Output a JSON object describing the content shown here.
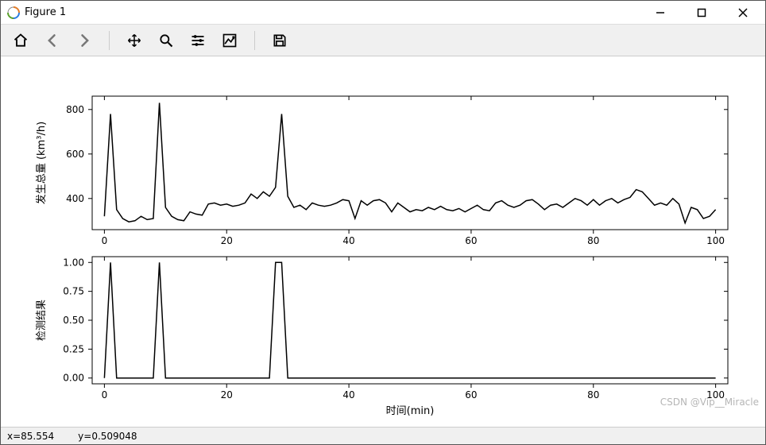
{
  "window": {
    "title": "Figure 1"
  },
  "toolbar": {
    "home": "home-icon",
    "back": "back-icon",
    "forward": "forward-icon",
    "pan": "pan-icon",
    "zoom": "zoom-icon",
    "configure": "configure-icon",
    "axes": "axes-icon",
    "save": "save-icon"
  },
  "status": {
    "x_label": "x=85.554",
    "y_label": "y=0.509048"
  },
  "watermark": "CSDN @Vip__Miracle",
  "shared_xlabel": "时间(min)",
  "chart_data": [
    {
      "type": "line",
      "title": "",
      "xlabel": "",
      "ylabel": "发生总量 (km³/h)",
      "xlim": [
        -2,
        102
      ],
      "ylim": [
        260,
        860
      ],
      "xticks": [
        0,
        20,
        40,
        60,
        80,
        100
      ],
      "yticks": [
        400,
        600,
        800
      ],
      "x": [
        0,
        1,
        2,
        3,
        4,
        5,
        6,
        7,
        8,
        9,
        10,
        11,
        12,
        13,
        14,
        15,
        16,
        17,
        18,
        19,
        20,
        21,
        22,
        23,
        24,
        25,
        26,
        27,
        28,
        29,
        30,
        31,
        32,
        33,
        34,
        35,
        36,
        37,
        38,
        39,
        40,
        41,
        42,
        43,
        44,
        45,
        46,
        47,
        48,
        49,
        50,
        51,
        52,
        53,
        54,
        55,
        56,
        57,
        58,
        59,
        60,
        61,
        62,
        63,
        64,
        65,
        66,
        67,
        68,
        69,
        70,
        71,
        72,
        73,
        74,
        75,
        76,
        77,
        78,
        79,
        80,
        81,
        82,
        83,
        84,
        85,
        86,
        87,
        88,
        89,
        90,
        91,
        92,
        93,
        94,
        95,
        96,
        97,
        98,
        99,
        100
      ],
      "values": [
        320,
        780,
        350,
        310,
        295,
        300,
        320,
        305,
        310,
        830,
        360,
        320,
        305,
        300,
        340,
        330,
        325,
        375,
        380,
        370,
        375,
        365,
        370,
        380,
        420,
        400,
        430,
        410,
        450,
        780,
        410,
        360,
        370,
        350,
        380,
        370,
        365,
        370,
        380,
        395,
        390,
        310,
        390,
        370,
        390,
        395,
        380,
        340,
        380,
        360,
        340,
        350,
        345,
        360,
        350,
        365,
        350,
        345,
        355,
        340,
        355,
        370,
        350,
        345,
        380,
        390,
        370,
        360,
        370,
        390,
        395,
        375,
        350,
        370,
        375,
        360,
        380,
        400,
        390,
        370,
        395,
        370,
        390,
        400,
        380,
        395,
        405,
        440,
        430,
        400,
        370,
        380,
        370,
        400,
        375,
        290,
        360,
        350,
        310,
        320,
        350
      ]
    },
    {
      "type": "line",
      "title": "",
      "xlabel": "时间(min)",
      "ylabel": "检测结果",
      "xlim": [
        -2,
        102
      ],
      "ylim": [
        -0.05,
        1.05
      ],
      "xticks": [
        0,
        20,
        40,
        60,
        80,
        100
      ],
      "yticks": [
        0.0,
        0.25,
        0.5,
        0.75,
        1.0
      ],
      "x": [
        0,
        1,
        2,
        3,
        4,
        5,
        6,
        7,
        8,
        9,
        10,
        11,
        12,
        13,
        14,
        15,
        16,
        17,
        18,
        19,
        20,
        21,
        22,
        23,
        24,
        25,
        26,
        27,
        28,
        29,
        30,
        31,
        32,
        33,
        34,
        35,
        36,
        37,
        38,
        39,
        40,
        41,
        42,
        43,
        44,
        45,
        46,
        47,
        48,
        49,
        50,
        51,
        52,
        53,
        54,
        55,
        56,
        57,
        58,
        59,
        60,
        61,
        62,
        63,
        64,
        65,
        66,
        67,
        68,
        69,
        70,
        71,
        72,
        73,
        74,
        75,
        76,
        77,
        78,
        79,
        80,
        81,
        82,
        83,
        84,
        85,
        86,
        87,
        88,
        89,
        90,
        91,
        92,
        93,
        94,
        95,
        96,
        97,
        98,
        99,
        100
      ],
      "values": [
        0,
        1,
        0,
        0,
        0,
        0,
        0,
        0,
        0,
        1,
        0,
        0,
        0,
        0,
        0,
        0,
        0,
        0,
        0,
        0,
        0,
        0,
        0,
        0,
        0,
        0,
        0,
        0,
        1,
        1,
        0,
        0,
        0,
        0,
        0,
        0,
        0,
        0,
        0,
        0,
        0,
        0,
        0,
        0,
        0,
        0,
        0,
        0,
        0,
        0,
        0,
        0,
        0,
        0,
        0,
        0,
        0,
        0,
        0,
        0,
        0,
        0,
        0,
        0,
        0,
        0,
        0,
        0,
        0,
        0,
        0,
        0,
        0,
        0,
        0,
        0,
        0,
        0,
        0,
        0,
        0,
        0,
        0,
        0,
        0,
        0,
        0,
        0,
        0,
        0,
        0,
        0,
        0,
        0,
        0,
        0,
        0,
        0,
        0,
        0,
        0
      ]
    }
  ]
}
